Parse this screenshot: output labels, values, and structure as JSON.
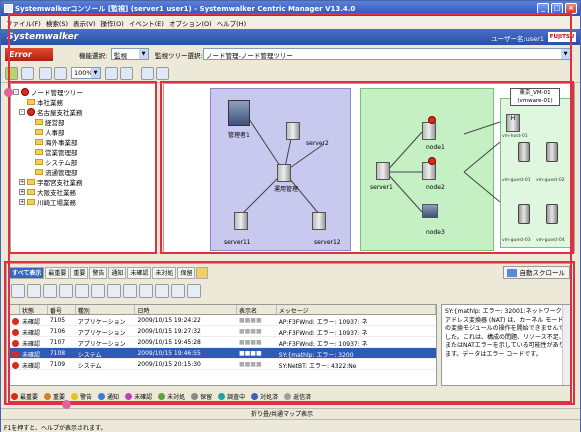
{
  "window": {
    "title": "Systemwalkerコンソール [監視] (server1 user1) - Systemwalker Centric Manager V13.4.0"
  },
  "menubar": [
    "ファイル(F)",
    "検索(S)",
    "表示(V)",
    "操作(O)",
    "イベント(E)",
    "オプション(O)",
    "ヘルプ(H)"
  ],
  "brand": {
    "logo": "Systemwalker",
    "user": "ユーザー名:user1",
    "vendor": "FUJITSU"
  },
  "toolbar": {
    "status_badge": "Error",
    "mode_label": "機能選択:",
    "mode_value": "監視",
    "tree_label": "監視ツリー選択:",
    "tree_value": "ノード管理-ノード管理ツリー",
    "zoom": "100%"
  },
  "tree": [
    "ノード管理ツリー",
    "本社業務",
    "名古屋支社業務",
    "経営部",
    "人事部",
    "海外事業部",
    "営業管理部",
    "システム部",
    "流通管理部",
    "宇都宮支社業務",
    "大阪支社業務",
    "川崎工場業務"
  ],
  "map": {
    "nodes": [
      "管理者1",
      "server2",
      "運用管理",
      "server11",
      "server12",
      "node1",
      "server1",
      "node2",
      "node3"
    ],
    "vm_label": "東京_VM-01 (vmware-01)",
    "vm_nodes": [
      "H",
      "vm-host-01",
      "vm-guest-01",
      "vm-guest-02",
      "vm-guest-03",
      "vm-guest-04"
    ]
  },
  "tabs": [
    "すべて表示",
    "最重要",
    "重要",
    "警告",
    "通知",
    "未確認",
    "未対処",
    "保留"
  ],
  "autoscroll": "自動スクロール",
  "table": {
    "columns": [
      "",
      "状態",
      "番号",
      "種別",
      "日時",
      "表示名",
      "メッセージ"
    ],
    "rows": [
      {
        "state": "未確認",
        "no": "7105",
        "kind": "アプリケーション",
        "date": "2009/10/15 19:24:22",
        "name": "■■■■",
        "msg": "AP:F3FWnd: エラー: 10937: ネ"
      },
      {
        "state": "未確認",
        "no": "7106",
        "kind": "アプリケーション",
        "date": "2009/10/15 19:27:32",
        "name": "■■■■",
        "msg": "AP:F3FWnd: エラー: 10937: ネ"
      },
      {
        "state": "未確認",
        "no": "7107",
        "kind": "アプリケーション",
        "date": "2009/10/15 19:45:28",
        "name": "■■■■",
        "msg": "AP:F3FWnd: エラー: 10937: ネ"
      },
      {
        "state": "未確認",
        "no": "7108",
        "kind": "システム",
        "date": "2009/10/15 19:46:55",
        "name": "■■■■",
        "msg": "SY:{mathlp: エラー: 3200"
      },
      {
        "state": "未確認",
        "no": "7109",
        "kind": "システム",
        "date": "2009/10/15 20:15:30",
        "name": "■■■■",
        "msg": "SY:NetBT: エラー: 4322:Ne"
      }
    ]
  },
  "detail": "SY:{mathlp: エラー: 32001:ネットワーク アドレス変換器 (NAT) は、カーネル モードの変換モジュールの操作を開始できませんでした。これは、構成の問題、リソース不足、またはNATエラーを示している可能性があります。データはエラー コードです。",
  "legend": [
    "最重要",
    "重要",
    "警告",
    "通知",
    "未確認",
    "未対処",
    "保留",
    "調査中",
    "対処済",
    "返信済"
  ],
  "statusbar": {
    "center": "折り畳/共通マップ表示",
    "left": "F1を押すと、ヘルプが表示されます。"
  }
}
